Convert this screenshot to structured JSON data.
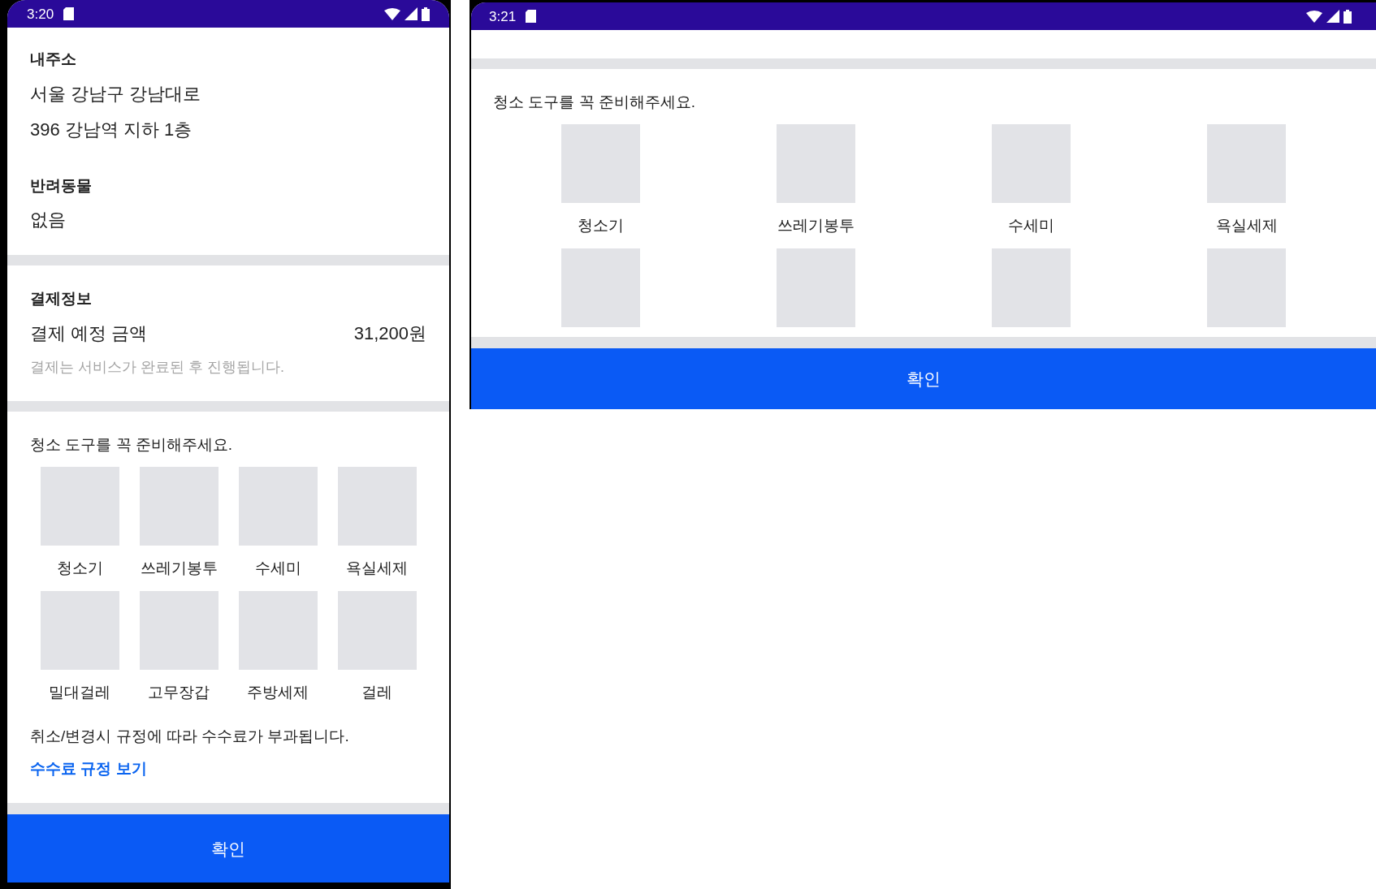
{
  "screens": [
    {
      "kind": "portrait",
      "status_bar": {
        "time": "3:20"
      },
      "address": {
        "title": "내주소",
        "lines": [
          "서울 강남구 강남대로",
          "396 강남역 지하 1층"
        ]
      },
      "pet": {
        "title": "반려동물",
        "value": "없음"
      },
      "payment": {
        "title": "결제정보",
        "label": "결제 예정 금액",
        "amount": "31,200원",
        "note": "결제는 서비스가 완료된 후 진행됩니다."
      },
      "tools": {
        "title": "청소 도구를 꼭 준비해주세요.",
        "items": [
          {
            "kind": "labeled",
            "label": "청소기"
          },
          {
            "kind": "labeled",
            "label": "쓰레기봉투"
          },
          {
            "kind": "labeled",
            "label": "수세미"
          },
          {
            "kind": "labeled",
            "label": "욕실세제"
          },
          {
            "kind": "labeled",
            "label": "밀대걸레"
          },
          {
            "kind": "labeled",
            "label": "고무장갑"
          },
          {
            "kind": "labeled",
            "label": "주방세제"
          },
          {
            "kind": "labeled",
            "label": "걸레"
          }
        ]
      },
      "fee_notice": "취소/변경시 규정에 따라 수수료가 부과됩니다.",
      "fee_link": "수수료 규정 보기",
      "confirm_button": "확인"
    },
    {
      "kind": "landscape",
      "status_bar": {
        "time": "3:21"
      },
      "tools": {
        "title": "청소 도구를 꼭 준비해주세요.",
        "items": [
          {
            "kind": "labeled",
            "label": "청소기"
          },
          {
            "kind": "labeled",
            "label": "쓰레기봉투"
          },
          {
            "kind": "labeled",
            "label": "수세미"
          },
          {
            "kind": "labeled",
            "label": "욕실세제"
          },
          {
            "kind": "image"
          },
          {
            "kind": "image"
          },
          {
            "kind": "image"
          },
          {
            "kind": "image"
          }
        ]
      },
      "confirm_button": "확인"
    }
  ]
}
